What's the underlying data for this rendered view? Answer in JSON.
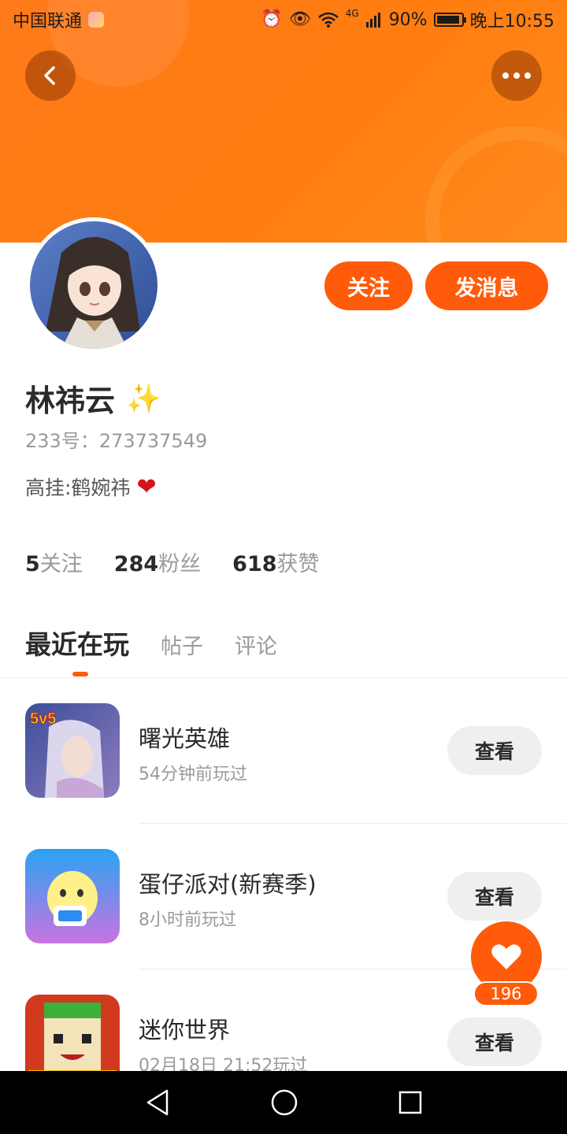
{
  "status_bar": {
    "carrier": "中国联通",
    "network": "4G",
    "battery": "90%",
    "time": "晚上10:55"
  },
  "header": {
    "back_icon": "chevron-left-icon",
    "more_icon": "more-dots-icon",
    "banner_color": "#ff7a14"
  },
  "profile": {
    "name": "林祎云",
    "badge_icon": "sparkle-icon",
    "uid_label": "233号：",
    "uid_value": "273737549",
    "bio_text": "高挂:鹤婉祎",
    "bio_emoji": "❤",
    "follow_label": "关注",
    "message_label": "发消息",
    "accent_color": "#ff5b0a"
  },
  "stats": [
    {
      "value": "5",
      "label": "关注"
    },
    {
      "value": "284",
      "label": "粉丝"
    },
    {
      "value": "618",
      "label": "获赞"
    }
  ],
  "tabs": [
    {
      "label": "最近在玩",
      "active": true
    },
    {
      "label": "帖子",
      "active": false
    },
    {
      "label": "评论",
      "active": false
    }
  ],
  "games": [
    {
      "title": "曙光英雄",
      "played": "54分钟前玩过",
      "button": "查看",
      "icon_badge": "5v5"
    },
    {
      "title": "蛋仔派对(新赛季)",
      "played": "8小时前玩过",
      "button": "查看",
      "icon_badge": ""
    },
    {
      "title": "迷你世界",
      "played": "02月18日 21:52玩过",
      "button": "查看",
      "icon_badge": ""
    }
  ],
  "like_fab": {
    "icon": "heart-icon",
    "count": "196"
  }
}
